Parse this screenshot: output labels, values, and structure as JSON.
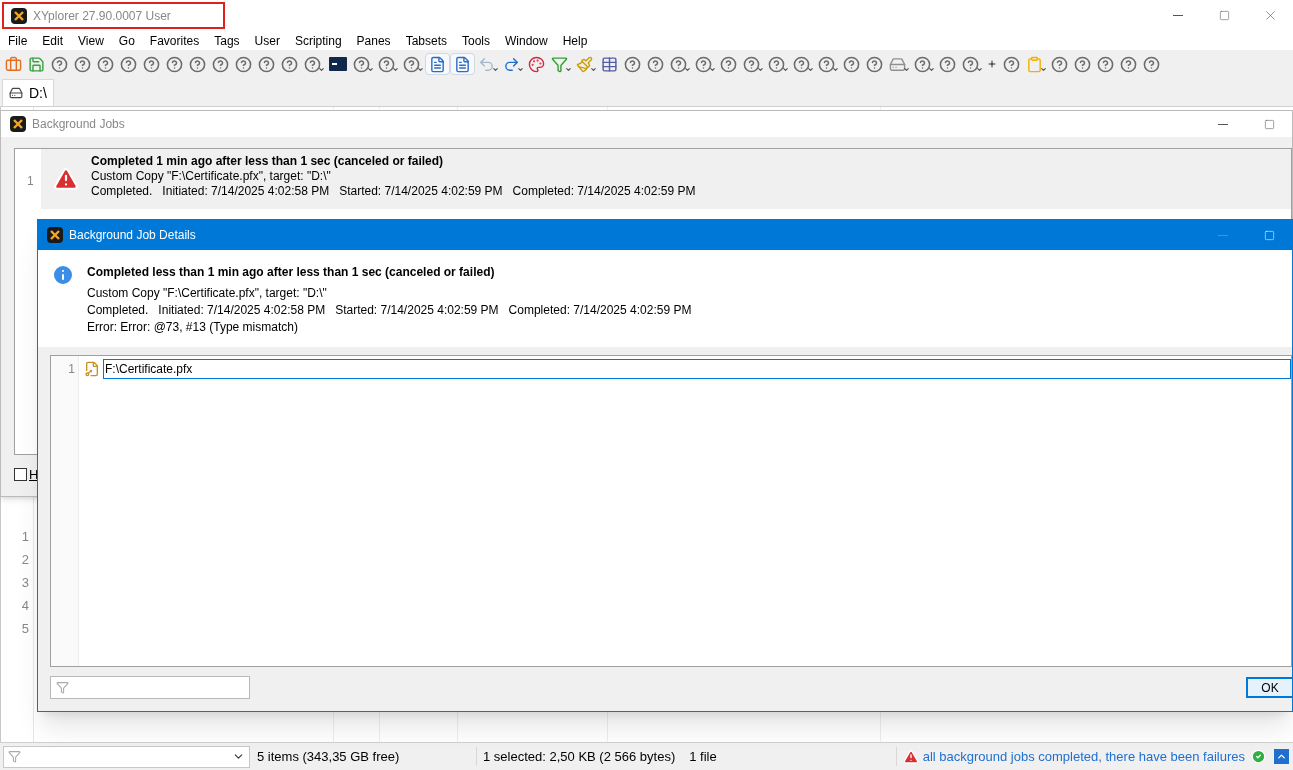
{
  "main_window": {
    "title": "XYplorer 27.90.0007 User",
    "title_highlighted": true,
    "menu": [
      "File",
      "Edit",
      "View",
      "Go",
      "Favorites",
      "Tags",
      "User",
      "Scripting",
      "Panes",
      "Tabsets",
      "Tools",
      "Window",
      "Help"
    ],
    "toolbar": [
      {
        "kind": "briefcase",
        "dropdown": false
      },
      {
        "kind": "save",
        "dropdown": false
      },
      {
        "kind": "help",
        "dropdown": false
      },
      {
        "kind": "help",
        "dropdown": false
      },
      {
        "kind": "help",
        "dropdown": false
      },
      {
        "kind": "help",
        "dropdown": false
      },
      {
        "kind": "help",
        "dropdown": false
      },
      {
        "kind": "help",
        "dropdown": false
      },
      {
        "kind": "help",
        "dropdown": false
      },
      {
        "kind": "help",
        "dropdown": false
      },
      {
        "kind": "help",
        "dropdown": false
      },
      {
        "kind": "help",
        "dropdown": false
      },
      {
        "kind": "help",
        "dropdown": false
      },
      {
        "kind": "help",
        "dropdown": true
      },
      {
        "kind": "console",
        "dropdown": false
      },
      {
        "kind": "help",
        "dropdown": true
      },
      {
        "kind": "help",
        "dropdown": true
      },
      {
        "kind": "help",
        "dropdown": true
      },
      {
        "kind": "doc",
        "dropdown": false
      },
      {
        "kind": "doc",
        "dropdown": false
      },
      {
        "kind": "undo",
        "dropdown": true
      },
      {
        "kind": "redo",
        "dropdown": true
      },
      {
        "kind": "color",
        "dropdown": false
      },
      {
        "kind": "filter",
        "dropdown": true
      },
      {
        "kind": "brush",
        "dropdown": true
      },
      {
        "kind": "grid",
        "dropdown": false
      },
      {
        "kind": "help",
        "dropdown": false
      },
      {
        "kind": "help",
        "dropdown": false
      },
      {
        "kind": "help",
        "dropdown": true
      },
      {
        "kind": "help",
        "dropdown": true
      },
      {
        "kind": "help",
        "dropdown": false
      },
      {
        "kind": "help",
        "dropdown": true
      },
      {
        "kind": "help",
        "dropdown": true
      },
      {
        "kind": "help",
        "dropdown": true
      },
      {
        "kind": "help",
        "dropdown": true
      },
      {
        "kind": "help",
        "dropdown": false
      },
      {
        "kind": "help",
        "dropdown": false
      },
      {
        "kind": "drive",
        "dropdown": true
      },
      {
        "kind": "help",
        "dropdown": true
      },
      {
        "kind": "help",
        "dropdown": false
      },
      {
        "kind": "help",
        "dropdown": true
      },
      {
        "kind": "plus",
        "dropdown": false
      },
      {
        "kind": "help",
        "dropdown": false
      },
      {
        "kind": "clipboard",
        "dropdown": true
      },
      {
        "kind": "help",
        "dropdown": false
      },
      {
        "kind": "help",
        "dropdown": false
      },
      {
        "kind": "help",
        "dropdown": false
      },
      {
        "kind": "help",
        "dropdown": false
      },
      {
        "kind": "help",
        "dropdown": false
      }
    ],
    "tabs": [
      {
        "label": "D:\\",
        "selected": true
      }
    ],
    "line_numbers": [
      "1",
      "2",
      "3",
      "4",
      "5"
    ],
    "status_bar": {
      "items": "5 items (343,35 GB free)",
      "selection": "1 selected: 2,50 KB (2 566 bytes)",
      "files": "1 file",
      "jobs_link": "all background jobs completed, there have been failures"
    }
  },
  "background_jobs": {
    "title": "Background Jobs",
    "jobs": [
      {
        "number": "1",
        "kind": "failed",
        "headline": "Completed 1 min ago after less than 1 sec (canceled or failed)",
        "description": "Custom Copy \"F:\\Certificate.pfx\", target: \"D:\\\"",
        "times": "Completed.   Initiated: 7/14/2025 4:02:58 PM   Started: 7/14/2025 4:02:59 PM   Completed: 7/14/2025 4:02:59 PM"
      }
    ],
    "checkbox": {
      "label": "H",
      "checked": false
    }
  },
  "details": {
    "title": "Background Job Details",
    "headline": "Completed less than 1 min ago after less than 1 sec (canceled or failed)",
    "lines": [
      "Custom Copy \"F:\\Certificate.pfx\", target: \"D:\\\"",
      "Completed.   Initiated: 7/14/2025 4:02:58 PM   Started: 7/14/2025 4:02:59 PM   Completed: 7/14/2025 4:02:59 PM",
      "Error: Error: @73, #13 (Type mismatch)"
    ],
    "items": [
      {
        "number": "1",
        "path": "F:\\Certificate.pfx"
      }
    ],
    "ok": "OK"
  }
}
